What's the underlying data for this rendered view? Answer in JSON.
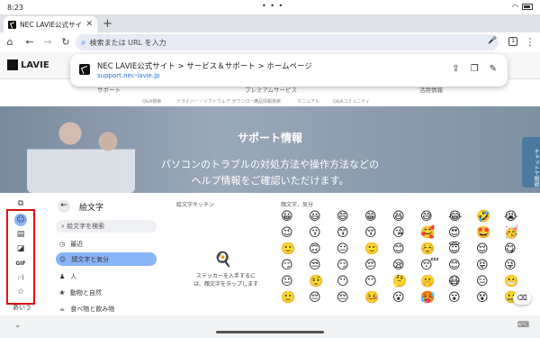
{
  "status": {
    "time": "8:23",
    "dots": "• • •"
  },
  "tab": {
    "title": "NEC LAVIE公式サイト",
    "close": "✕",
    "new": "+"
  },
  "toolbar": {
    "home": "⌂",
    "back": "←",
    "forward": "→",
    "reload": "↻",
    "search_icon": "⌕",
    "placeholder": "検索または URL を入力",
    "mic": "🎤",
    "tab_count": "1",
    "menu": "⋮"
  },
  "site": {
    "logo": "LAVIE",
    "nav": [
      "サポート",
      "プレミアムサービス",
      "活用情報"
    ],
    "subnav": [
      "Q&A検索",
      "ドライバー・ソフトウェア ダウンロード",
      "商品情報検索",
      "マニュアル",
      "Q&Aコミュニティ"
    ],
    "hero_title": "サポート情報",
    "hero_line1": "パソコンのトラブルの対処方法や操作方法などの",
    "hero_line2": "ヘルプ情報をご確認いただけます。",
    "chat": "チャットで相談"
  },
  "popup": {
    "title": "NEC LAVIE公式サイト > サービス＆サポート > ホームページ",
    "url": "support.nec-lavie.jp",
    "share": "⇪",
    "copy": "❐",
    "edit": "✎"
  },
  "keyboard": {
    "rail": {
      "sticker_icon": "⧉",
      "emoji_icon": "☺",
      "emoticon_icon": "▤",
      "sticker2_icon": "◪",
      "gif": "GIF",
      "kaomoji": ":-)",
      "star_icon": "☆",
      "abc": "あいう"
    },
    "header": "絵文字",
    "back": "←",
    "search": "絵文字を検索",
    "categories": [
      {
        "icon": "◷",
        "label": "最近"
      },
      {
        "icon": "☺",
        "label": "顔文字と気分"
      },
      {
        "icon": "♟",
        "label": "人"
      },
      {
        "icon": "❀",
        "label": "動物と自然"
      },
      {
        "icon": "☕",
        "label": "食べ物と飲み物"
      }
    ],
    "kitchen_title": "絵文字キッチン",
    "kitchen_img": "🍳",
    "kitchen_msg1": "ステッカーを入手するに",
    "kitchen_msg2": "は、顔文字をタップします",
    "emoji_title": "顔文字、気分",
    "emojis": [
      "😀",
      "😃",
      "😄",
      "😁",
      "😆",
      "😅",
      "😂",
      "🤣",
      "😭",
      "😉",
      "😗",
      "😙",
      "😚",
      "😘",
      "🥰",
      "😍",
      "🤩",
      "🥳",
      "🙂",
      "🙃",
      "😐",
      "🙂",
      "😊",
      "☺️",
      "😇",
      "😌",
      "😋",
      "😏",
      "😒",
      "😏",
      "😔",
      "😪",
      "😴",
      "😊",
      "😝",
      "😜",
      "😐",
      "🤨",
      "😶",
      "😶",
      "🤔",
      "🤫",
      "😷",
      "😑",
      "😬",
      "🙂",
      "😔",
      "😔",
      "🤒",
      "😮",
      "🥵",
      "😮",
      "😵",
      "🤐"
    ],
    "backspace": "⌫"
  },
  "navbar": {
    "chevron": "⌄",
    "keyboard": "⌨"
  }
}
